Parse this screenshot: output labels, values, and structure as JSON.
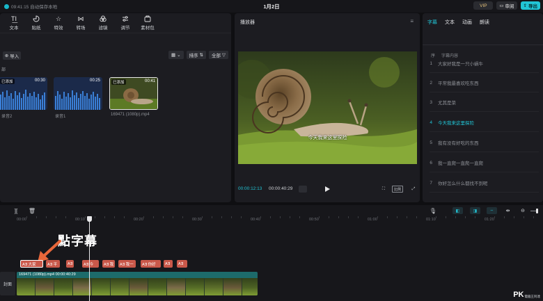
{
  "topbar": {
    "status_text": "09:41:15 自动保存本地",
    "project_title": "1月2日",
    "vip_label": "VIP",
    "review_label": "审阅",
    "export_label": "导出"
  },
  "media": {
    "tools": [
      {
        "label": "文本",
        "icon": "text-icon"
      },
      {
        "label": "贴纸",
        "icon": "sticker-icon"
      },
      {
        "label": "特效",
        "icon": "effects-icon"
      },
      {
        "label": "转场",
        "icon": "transition-icon"
      },
      {
        "label": "滤镜",
        "icon": "filter-icon"
      },
      {
        "label": "调节",
        "icon": "adjust-icon"
      },
      {
        "label": "素材包",
        "icon": "pack-icon"
      }
    ],
    "import_label": "导入",
    "section_label": "部",
    "sort_label": "排序",
    "filter_label": "全部",
    "clips": [
      {
        "badge": "已添加",
        "duration": "00:30",
        "name": "录音2",
        "kind": "audio"
      },
      {
        "badge": "",
        "duration": "00:25",
        "name": "录音1",
        "kind": "audio"
      },
      {
        "badge": "已添加",
        "duration": "00:41",
        "name": "169471 (1080p).mp4",
        "kind": "video"
      }
    ]
  },
  "player": {
    "title": "播放器",
    "caption": "今天我来这里探险",
    "current_time": "00:00:12:13",
    "total_time": "00:00:40:29",
    "ratio_label": "比例"
  },
  "subtitles": {
    "tabs": [
      "字幕",
      "文本",
      "动画",
      "朗读"
    ],
    "active_tab": 0,
    "header_index": "序",
    "header_content": "字幕内容",
    "rows": [
      {
        "n": "1",
        "text": "大家好我是一只小蜗牛"
      },
      {
        "n": "2",
        "text": "平常我最喜欢吃东西"
      },
      {
        "n": "3",
        "text": "尤其是菜"
      },
      {
        "n": "4",
        "text": "今天我来这里探险"
      },
      {
        "n": "5",
        "text": "我有没有好吃的东西"
      },
      {
        "n": "6",
        "text": "我一直爬一直爬一直爬"
      },
      {
        "n": "7",
        "text": "你好怎么什么都找不到呢"
      }
    ],
    "active_row": 3,
    "accent": "#21c5d6"
  },
  "timeline": {
    "ruler_labels": [
      "00:00",
      "00:10",
      "00:20",
      "00:30",
      "00:40",
      "00:50",
      "01:00",
      "01:10",
      "01:20"
    ],
    "annotation": "點字幕",
    "subtitle_clips": [
      "A∃ 大家",
      "A∃ 平",
      "A∃",
      "A∃ 今",
      "A∃ 我",
      "A∃ 我一",
      "A∃ 你好",
      "A∃",
      "A∃"
    ],
    "video_clip_label": "169471 (1080p).mp4 00:00:40:29",
    "cover_label": "封面"
  },
  "watermark": {
    "brand": "PK",
    "site": "電腦王阿達"
  },
  "colors": {
    "accent": "#21c5d6",
    "subtitle_clip": "#c9584a",
    "video_track": "#1d6b6b",
    "annotation_arrow": "#e8673a"
  }
}
